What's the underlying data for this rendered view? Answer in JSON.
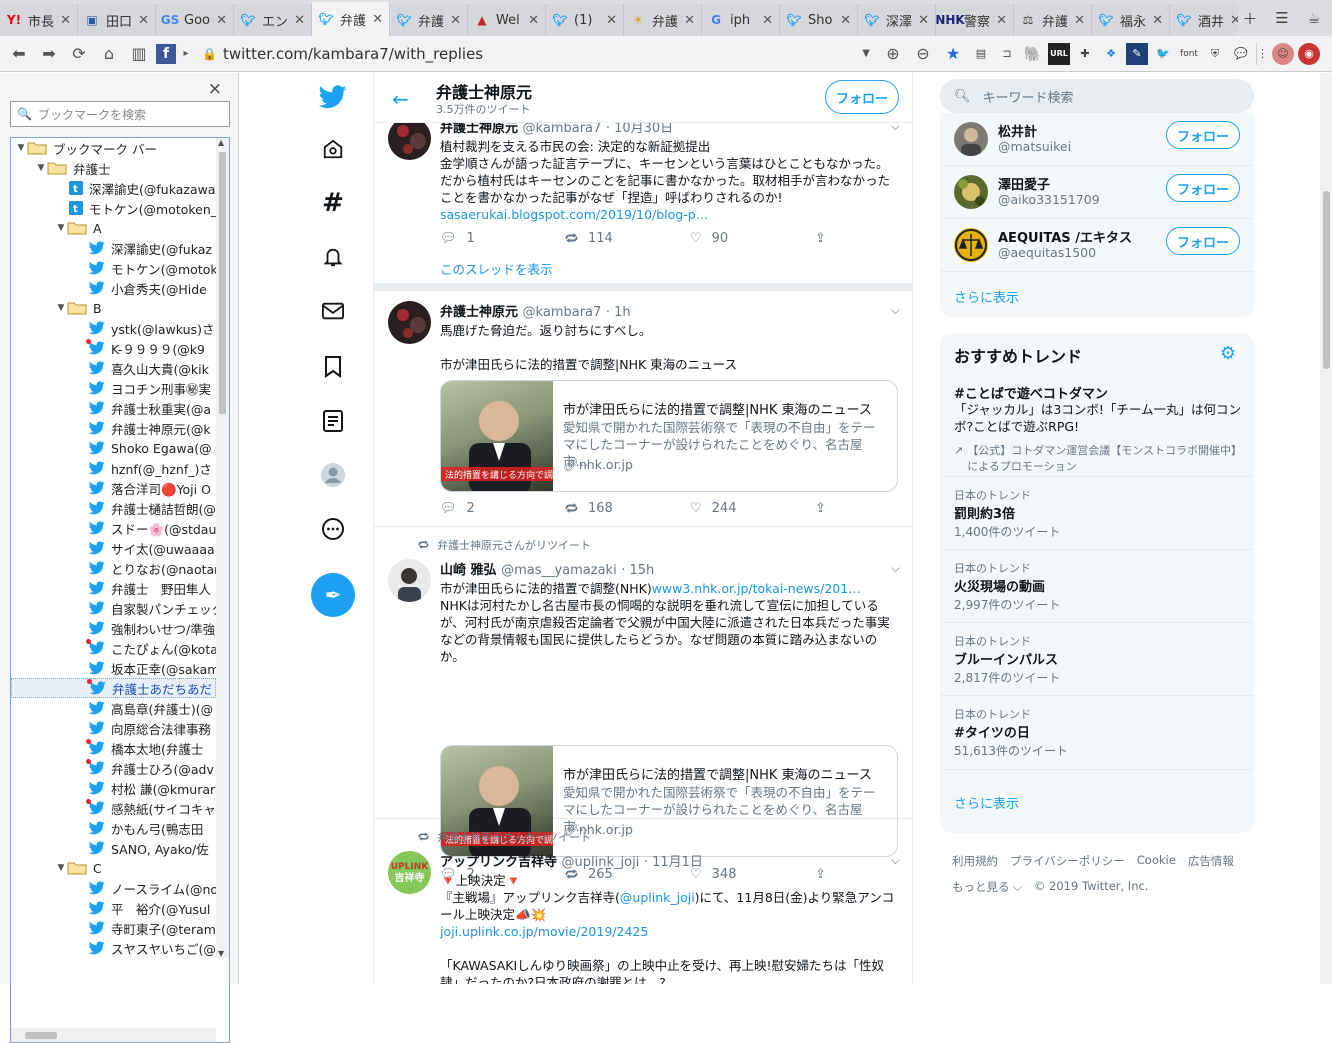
{
  "tabs": [
    {
      "icon": "Y!",
      "color": "#e60012",
      "label": "市長"
    },
    {
      "icon": "▣",
      "color": "#2a5aa8",
      "label": "田口"
    },
    {
      "icon": "GS",
      "color": "#4285f4",
      "label": "Goo"
    },
    {
      "icon": "tw",
      "color": "#1da1f2",
      "label": "エン"
    },
    {
      "icon": "tw",
      "color": "#1da1f2",
      "label": "弁護"
    },
    {
      "icon": "tw",
      "color": "#1da1f2",
      "label": "弁護"
    },
    {
      "icon": "▲",
      "color": "#c62828",
      "label": "Wel"
    },
    {
      "icon": "tw",
      "color": "#1da1f2",
      "label": "(1)"
    },
    {
      "icon": "☀",
      "color": "#e6a11e",
      "label": "弁護"
    },
    {
      "icon": "G",
      "color": "#4285f4",
      "label": "iph"
    },
    {
      "icon": "tw",
      "color": "#1da1f2",
      "label": "Sho"
    },
    {
      "icon": "tw",
      "color": "#1da1f2",
      "label": "深澤"
    },
    {
      "icon": "NHK",
      "color": "#1a237e",
      "label": "警察"
    },
    {
      "icon": "⚖",
      "color": "#444",
      "label": "弁護"
    },
    {
      "icon": "tw",
      "color": "#1da1f2",
      "label": "福永"
    },
    {
      "icon": "tw",
      "color": "#1da1f2",
      "label": "酒井"
    }
  ],
  "url": "twitter.com/kambara7/with_replies",
  "extensions": [
    "URL",
    "font"
  ],
  "sidebar": {
    "search_placeholder": "ブックマークを検索",
    "close": "×",
    "tree": [
      {
        "type": "folder",
        "depth": 0,
        "open": true,
        "label": "ブックマーク バー"
      },
      {
        "type": "folder",
        "depth": 1,
        "open": true,
        "label": "弁護士"
      },
      {
        "type": "tb",
        "depth": 2,
        "label": "深澤諭史(@fukazawa"
      },
      {
        "type": "tb",
        "depth": 2,
        "label": "モトケン(@motoken_"
      },
      {
        "type": "folder",
        "depth": 2,
        "open": true,
        "label": "A"
      },
      {
        "type": "tw",
        "depth": 3,
        "label": "深澤諭史(@fukaz"
      },
      {
        "type": "tw",
        "depth": 3,
        "label": "モトケン(@motok"
      },
      {
        "type": "tw",
        "depth": 3,
        "label": "小倉秀夫(@Hide"
      },
      {
        "type": "folder",
        "depth": 2,
        "open": true,
        "label": "B"
      },
      {
        "type": "tw",
        "depth": 3,
        "label": "ystk(@lawkus)さ"
      },
      {
        "type": "tw",
        "depth": 3,
        "dot": true,
        "label": "K-９９９９(@k9"
      },
      {
        "type": "tw",
        "depth": 3,
        "label": "喜久山大貴(@kik"
      },
      {
        "type": "tw",
        "depth": 3,
        "label": "ヨコチン刑事㊙実"
      },
      {
        "type": "tw",
        "depth": 3,
        "label": "弁護士秋重実(@a"
      },
      {
        "type": "tw",
        "depth": 3,
        "label": "弁護士神原元(@k"
      },
      {
        "type": "tw",
        "depth": 3,
        "label": "Shoko Egawa(@"
      },
      {
        "type": "tw",
        "depth": 3,
        "label": "hznf(@_hznf_)さ"
      },
      {
        "type": "tw",
        "depth": 3,
        "label": "落合洋司🔴Yoji O"
      },
      {
        "type": "tw",
        "depth": 3,
        "label": "弁護士樋詰哲朗(@"
      },
      {
        "type": "tw",
        "depth": 3,
        "label": "スドー🌸(@stdau"
      },
      {
        "type": "tw",
        "depth": 3,
        "label": "サイ太(@uwaaaa)"
      },
      {
        "type": "tw",
        "depth": 3,
        "label": "とりなお(@naotar"
      },
      {
        "type": "tw",
        "depth": 3,
        "label": "弁護士　野田隼人"
      },
      {
        "type": "tw",
        "depth": 3,
        "label": "自家製パンチェッタ"
      },
      {
        "type": "tw",
        "depth": 3,
        "label": "強制わいせつ/準強"
      },
      {
        "type": "tw",
        "depth": 3,
        "dot": true,
        "label": "こたぴょん(@kota"
      },
      {
        "type": "tw",
        "depth": 3,
        "label": "坂本正幸(@sakam"
      },
      {
        "type": "tw",
        "depth": 3,
        "dot": true,
        "selected": true,
        "label": "弁護士あだちあだ"
      },
      {
        "type": "tw",
        "depth": 3,
        "label": "高島章(弁護士)(@"
      },
      {
        "type": "tw",
        "depth": 3,
        "label": "向原総合法律事務"
      },
      {
        "type": "tw",
        "depth": 3,
        "dot": true,
        "label": "橋本太地(弁護士"
      },
      {
        "type": "tw",
        "depth": 3,
        "dot": true,
        "label": "弁護士ひろ(@adv"
      },
      {
        "type": "tw",
        "depth": 3,
        "label": "村松 謙(@kmurar"
      },
      {
        "type": "tw",
        "depth": 3,
        "dot": true,
        "label": "感熱紙(サイコキャ"
      },
      {
        "type": "tw",
        "depth": 3,
        "label": "かもん弓(鴨志田"
      },
      {
        "type": "tw",
        "depth": 3,
        "label": "SANO, Ayako/佐"
      },
      {
        "type": "folder",
        "depth": 2,
        "open": true,
        "label": "C"
      },
      {
        "type": "tw",
        "depth": 3,
        "label": "ノースライム(@no"
      },
      {
        "type": "tw",
        "depth": 3,
        "label": "平　裕介(@Yusul"
      },
      {
        "type": "tw",
        "depth": 3,
        "label": "寺町東子(@teram"
      },
      {
        "type": "tw",
        "depth": 3,
        "label": "スヤスヤいちご(@"
      }
    ]
  },
  "header": {
    "title": "弁護士神原元",
    "subtitle": "3.5万件のツイート",
    "follow": "フォロー"
  },
  "tweets": [
    {
      "name": "弁護士神原元",
      "handle": "@kambara7",
      "time": "· 10月30日",
      "lines": [
        "植村裁判を支える市民の会: 決定的な新証拠提出",
        "金学順さんが語った証言テープに、キーセンという言葉はひとこともなかった。だから植村氏はキーセンのことを記事に書かなかった。取材相手が言わなかったことを書かなかった記事がなぜ「捏造」呼ばわりされるのか!"
      ],
      "link": "sasaerukai.blogspot.com/2019/10/blog-p…",
      "replies": "1",
      "retweets": "114",
      "likes": "90",
      "thread": "このスレッドを表示"
    },
    {
      "name": "弁護士神原元",
      "handle": "@kambara7",
      "time": "· 1h",
      "lines": [
        "馬鹿げた脅迫だ。返り討ちにすべし。",
        "",
        "市が津田氏らに法的措置で調整|NHK 東海のニュース"
      ],
      "card": {
        "title": "市が津田氏らに法的措置で調整|NHK 東海のニュース",
        "desc": "愛知県で開かれた国際芸術祭で「表現の不自由」をテーマにしたコーナーが設けられたことをめぐり、名古屋市…",
        "url": "nhk.or.jp",
        "caption": "法的措置を講じる方向で調整"
      },
      "replies": "2",
      "retweets": "168",
      "likes": "244"
    },
    {
      "rt": "弁護士神原元さんがリツイート",
      "name": "山崎 雅弘",
      "handle": "@mas__yamazaki",
      "time": "· 15h",
      "first": "市が津田氏らに法的措置で調整(NHK)",
      "first_link": "www3.nhk.or.jp/tokai-news/201…",
      "lines": [
        "NHKは河村たかし名古屋市長の恫喝的な説明を垂れ流して宣伝に加担しているが、河村氏が南京虐殺否定論者で父親が中国大陸に派遣された日本兵だった事実などの背景情報も国民に提供したらどうか。なぜ問題の本質に踏み込まないのか。"
      ],
      "card": {
        "title": "市が津田氏らに法的措置で調整|NHK 東海のニュース",
        "desc": "愛知県で開かれた国際芸術祭で「表現の不自由」をテーマにしたコーナーが設けられたことをめぐり、名古屋市…",
        "url": "nhk.or.jp",
        "caption": "法的措置を講じる方向で調整"
      },
      "replies": "2",
      "retweets": "265",
      "likes": "348"
    },
    {
      "rt": "弁護士神原元さんがリツイート",
      "name": "アップリンク吉祥寺",
      "handle": "@uplink_joji",
      "time": "· 11月1日",
      "avatar_text": [
        "UPLINK",
        "吉祥寺"
      ],
      "l1": "🔻上映決定🔻",
      "l2a": "『主戦場』アップリンク吉祥寺(",
      "l2link": "@uplink_joji",
      "l2b": ")にて、11月8日(金)より緊急アンコール上映決定📣💥",
      "link": "joji.uplink.co.jp/movie/2019/2425",
      "l4": "「KAWASAKIしんゆり映画祭」の上映中止を受け、再上映!慰安婦たちは「性奴隷」だったのか?日本政府の謝罪とは…?"
    }
  ],
  "right": {
    "search_placeholder": "キーワード検索",
    "who_to_follow": [
      {
        "name": "松井計",
        "handle": "@matsuikei",
        "color": "#7d7a72"
      },
      {
        "name": "澤田愛子",
        "handle": "@aiko33151709",
        "color": "#5b6b2e"
      },
      {
        "name": "AEQUITAS /エキタス",
        "handle": "@aequitas1500",
        "color": "#e2b400"
      }
    ],
    "follow": "フォロー",
    "show_more": "さらに表示",
    "trends_title": "おすすめトレンド",
    "promoted": {
      "tag": "#ことばで遊べコトダマン",
      "desc": "「ジャッカル」は3コンボ!「チーム一丸」は何コンボ?ことばで遊ぶRPG!",
      "by": "【公式】コトダマン運営会議【モンストコラボ開催中】によるプロモーション"
    },
    "trends": [
      {
        "meta": "日本のトレンド",
        "name": "罰則約3倍",
        "count": "1,400件のツイート"
      },
      {
        "meta": "日本のトレンド",
        "name": "火災現場の動画",
        "count": "2,997件のツイート"
      },
      {
        "meta": "日本のトレンド",
        "name": "ブルーインパルス",
        "count": "2,817件のツイート"
      },
      {
        "meta": "日本のトレンド",
        "name": "#タイツの日",
        "count": "51,613件のツイート"
      }
    ],
    "footer1": [
      "利用規約",
      "プライバシーポリシー",
      "Cookie",
      "広告情報"
    ],
    "footer_more": "もっと見る ⌵",
    "copyright": "© 2019 Twitter, Inc."
  }
}
